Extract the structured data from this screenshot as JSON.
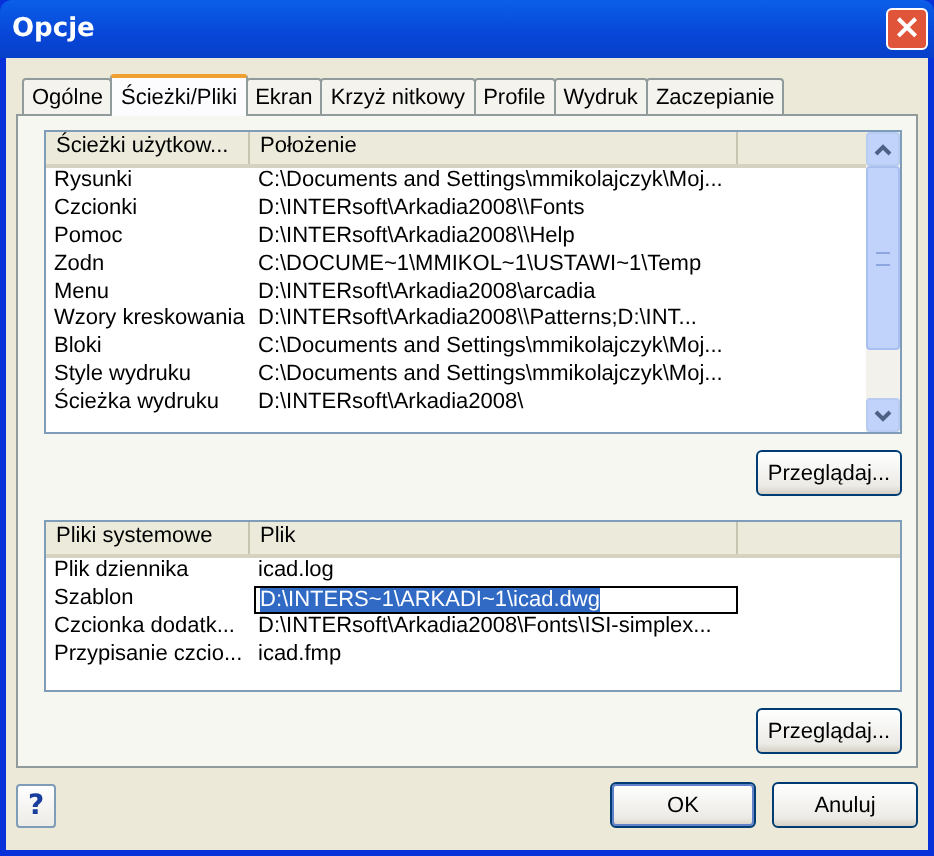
{
  "window": {
    "title": "Opcje",
    "close": "×"
  },
  "tabs": [
    {
      "label": "Ogólne",
      "selected": false
    },
    {
      "label": "Ścieżki/Pliki",
      "selected": true
    },
    {
      "label": "Ekran",
      "selected": false
    },
    {
      "label": "Krzyż nitkowy",
      "selected": false
    },
    {
      "label": "Profile",
      "selected": false
    },
    {
      "label": "Wydruk",
      "selected": false
    },
    {
      "label": "Zaczepianie",
      "selected": false
    }
  ],
  "user_paths": {
    "columns": [
      "Ścieżki użytkow...",
      "Położenie"
    ],
    "rows": [
      {
        "name": "Rysunki",
        "path": "C:\\Documents and Settings\\mmikolajczyk\\Moj..."
      },
      {
        "name": "Czcionki",
        "path": "D:\\INTERsoft\\Arkadia2008\\\\Fonts"
      },
      {
        "name": "Pomoc",
        "path": "D:\\INTERsoft\\Arkadia2008\\\\Help"
      },
      {
        "name": "Zodn",
        "path": "C:\\DOCUME~1\\MMIKOL~1\\USTAWI~1\\Temp"
      },
      {
        "name": "Menu",
        "path": "D:\\INTERsoft\\Arkadia2008\\arcadia"
      },
      {
        "name": "Wzory kreskowania",
        "path": "D:\\INTERsoft\\Arkadia2008\\\\Patterns;D:\\INT..."
      },
      {
        "name": "Bloki",
        "path": "C:\\Documents and Settings\\mmikolajczyk\\Moj..."
      },
      {
        "name": "Style wydruku",
        "path": "C:\\Documents and Settings\\mmikolajczyk\\Moj..."
      },
      {
        "name": "Ścieżka wydruku",
        "path": "D:\\INTERsoft\\Arkadia2008\\"
      }
    ],
    "button": "Przeglądaj..."
  },
  "system_files": {
    "columns": [
      "Pliki systemowe",
      "Plik"
    ],
    "rows": [
      {
        "name": "Plik dziennika",
        "path": "icad.log",
        "editing": false
      },
      {
        "name": "Szablon",
        "path": "D:\\INTERS~1\\ARKADI~1\\icad.dwg",
        "editing": true
      },
      {
        "name": "Czcionka dodatk...",
        "path": "D:\\INTERsoft\\Arkadia2008\\Fonts\\ISI-simplex...",
        "editing": false
      },
      {
        "name": "Przypisanie czcio...",
        "path": "icad.fmp",
        "editing": false
      }
    ],
    "button": "Przeglądaj..."
  },
  "footer": {
    "help": "?",
    "buttons": [
      {
        "label": "OK",
        "default": true
      },
      {
        "label": "Anuluj",
        "default": false
      }
    ]
  }
}
